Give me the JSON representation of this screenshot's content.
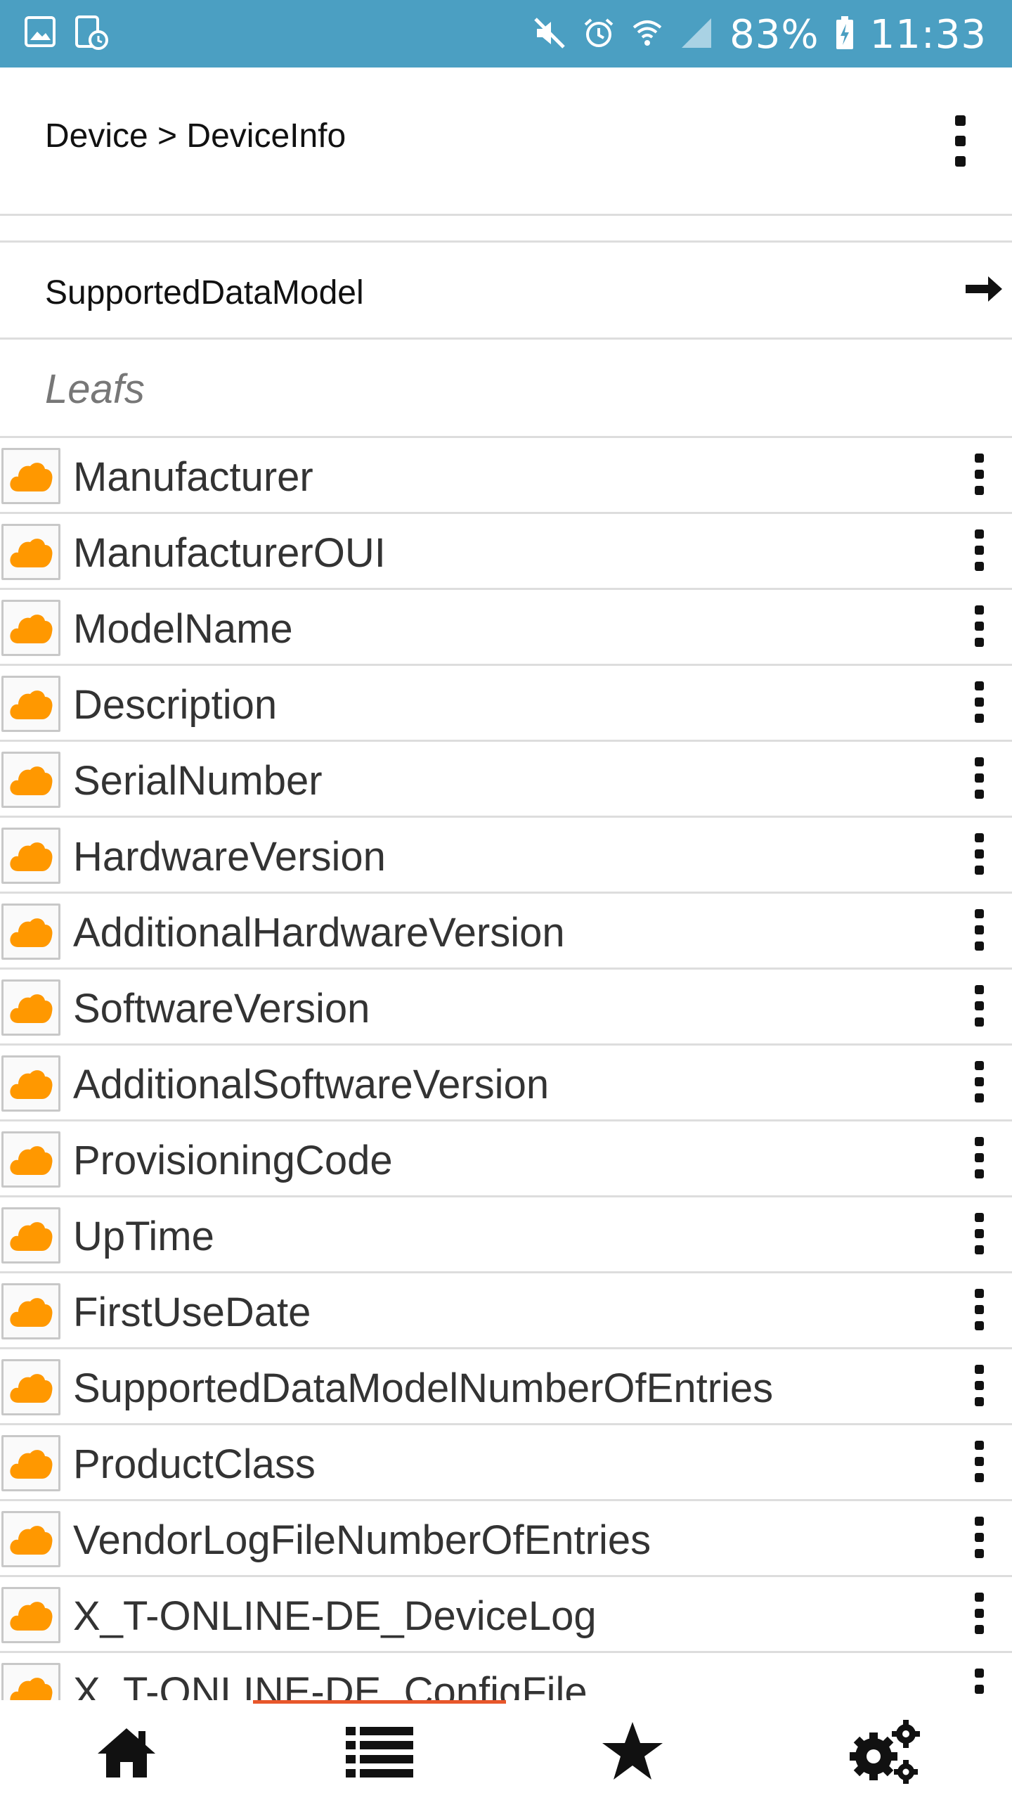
{
  "status_bar": {
    "battery": "83%",
    "time": "11:33",
    "icons": [
      "image-icon",
      "screenshot-icon",
      "mute-icon",
      "alarm-icon",
      "wifi-icon",
      "signal-icon",
      "battery-charging-icon"
    ]
  },
  "header": {
    "breadcrumb": "Device > DeviceInfo",
    "menu_icon": "more-vert-icon"
  },
  "child_objects": [
    {
      "label": "SupportedDataModel",
      "icon": "arrow-right-icon"
    }
  ],
  "leafs_section": {
    "title": "Leafs",
    "items": [
      {
        "label": "Manufacturer"
      },
      {
        "label": "ManufacturerOUI"
      },
      {
        "label": "ModelName"
      },
      {
        "label": "Description"
      },
      {
        "label": "SerialNumber"
      },
      {
        "label": "HardwareVersion"
      },
      {
        "label": "AdditionalHardwareVersion"
      },
      {
        "label": "SoftwareVersion"
      },
      {
        "label": "AdditionalSoftwareVersion"
      },
      {
        "label": "ProvisioningCode"
      },
      {
        "label": "UpTime"
      },
      {
        "label": "FirstUseDate"
      },
      {
        "label": "SupportedDataModelNumberOfEntries"
      },
      {
        "label": "ProductClass"
      },
      {
        "label": "VendorLogFileNumberOfEntries"
      },
      {
        "label": "X_T-ONLINE-DE_DeviceLog"
      },
      {
        "label": "X_T-ONLINE-DE_ConfigFile"
      }
    ]
  },
  "bottom_nav": {
    "items": [
      "home-icon",
      "list-icon",
      "star-icon",
      "settings-icon"
    ],
    "active_index": 1
  },
  "colors": {
    "status_bar": "#4b9fc2",
    "cloud_icon": "#ff9800",
    "active_indicator": "#e8572b"
  }
}
